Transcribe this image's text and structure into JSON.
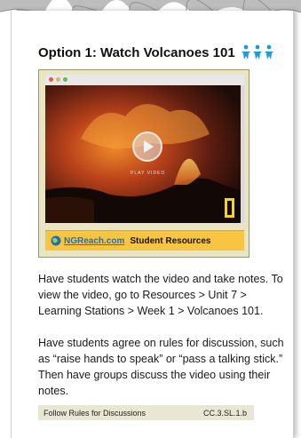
{
  "activity": {
    "title": "Option 1: Watch Volcanoes 101",
    "icon": "group-of-people-icon",
    "icon_color": "#1f9ad6"
  },
  "video": {
    "play_label": "PLAY VIDEO",
    "link_text": "NGReach.com",
    "resources_label": "Student Resources",
    "bar_color": "#f7c542",
    "marker_color": "#ffd400"
  },
  "body": {
    "paragraph_1": "Have students watch the video and take notes. To view the video, go to Resources > Unit 7 > Learning Stations > Week 1 > Volcanoes 101.",
    "paragraph_2": "Have students agree on rules for discussion, such as “raise hands to speak” or “pass a talking stick.” Then have groups discuss the video using their notes."
  },
  "footer": {
    "skill": "Follow Rules for Discussions",
    "standard": "CC.3.SL.1.b"
  }
}
